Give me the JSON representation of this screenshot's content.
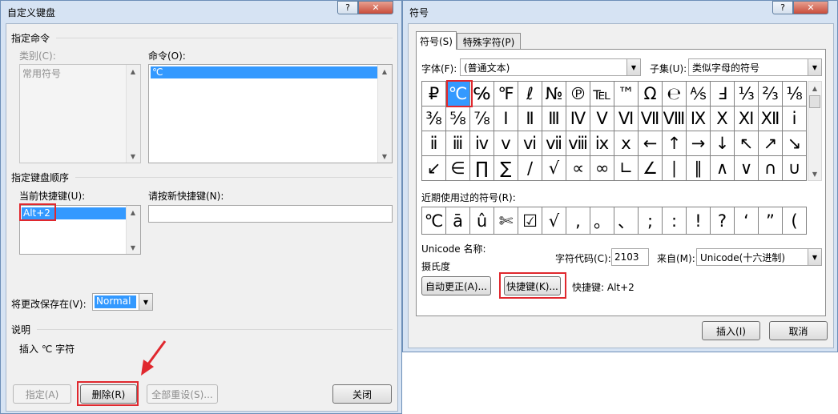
{
  "left_dialog": {
    "title": "自定义键盘",
    "help_label": "?",
    "close_label": "✕",
    "specify_command_group": "指定命令",
    "category_label": "类别(C):",
    "category_items": [
      "常用符号"
    ],
    "command_label": "命令(O):",
    "command_items": [
      "℃"
    ],
    "key_sequence_group": "指定键盘顺序",
    "current_keys_label": "当前快捷键(U):",
    "current_keys": [
      "Alt+2"
    ],
    "new_key_label": "请按新快捷键(N):",
    "new_key_value": "",
    "save_in_label": "将更改保存在(V):",
    "save_in_value": "Normal",
    "description_group": "说明",
    "description_text": "插入 ℃ 字符",
    "buttons": {
      "assign": "指定(A)",
      "remove": "删除(R)",
      "reset_all": "全部重设(S)...",
      "close": "关闭"
    }
  },
  "right_dialog": {
    "title": "符号",
    "help_label": "?",
    "close_label": "✕",
    "tabs": [
      "符号(S)",
      "特殊字符(P)"
    ],
    "font_label": "字体(F):",
    "font_value": "(普通文本)",
    "subset_label": "子集(U):",
    "subset_value": "类似字母的符号",
    "symbols": [
      [
        "₽",
        "℃",
        "℅",
        "℉",
        "ℓ",
        "№",
        "℗",
        "℡",
        "™",
        "Ω",
        "℮",
        "⅍",
        "Ⅎ",
        "⅓",
        "⅔",
        "⅛"
      ],
      [
        "⅜",
        "⅝",
        "⅞",
        "Ⅰ",
        "Ⅱ",
        "Ⅲ",
        "Ⅳ",
        "Ⅴ",
        "Ⅵ",
        "Ⅶ",
        "Ⅷ",
        "Ⅸ",
        "Ⅹ",
        "Ⅺ",
        "Ⅻ",
        "ⅰ"
      ],
      [
        "ⅱ",
        "ⅲ",
        "ⅳ",
        "ⅴ",
        "ⅵ",
        "ⅶ",
        "ⅷ",
        "ⅸ",
        "ⅹ",
        "←",
        "↑",
        "→",
        "↓",
        "↖",
        "↗",
        "↘"
      ],
      [
        "↙",
        "∈",
        "∏",
        "∑",
        "∕",
        "√",
        "∝",
        "∞",
        "∟",
        "∠",
        "∣",
        "∥",
        "∧",
        "∨",
        "∩",
        "∪"
      ]
    ],
    "recent_label": "近期使用过的符号(R):",
    "recent_symbols": [
      "℃",
      "ā",
      "û",
      "✄",
      "☑",
      "√",
      ",",
      "。",
      "、",
      ";",
      ":",
      "!",
      "?",
      "‘",
      "”",
      "("
    ],
    "unicode_name_label": "Unicode 名称:",
    "unicode_name_value": "摄氏度",
    "char_code_label": "字符代码(C):",
    "char_code_value": "2103",
    "from_label": "来自(M):",
    "from_value": "Unicode(十六进制)",
    "autocorrect_button": "自动更正(A)...",
    "shortcut_button": "快捷键(K)...",
    "shortcut_info": "快捷键: Alt+2",
    "insert_button": "插入(I)",
    "cancel_button": "取消"
  },
  "colors": {
    "highlight": "#e0282e",
    "selection": "#3399ff",
    "frame": "#d6e3f3"
  }
}
